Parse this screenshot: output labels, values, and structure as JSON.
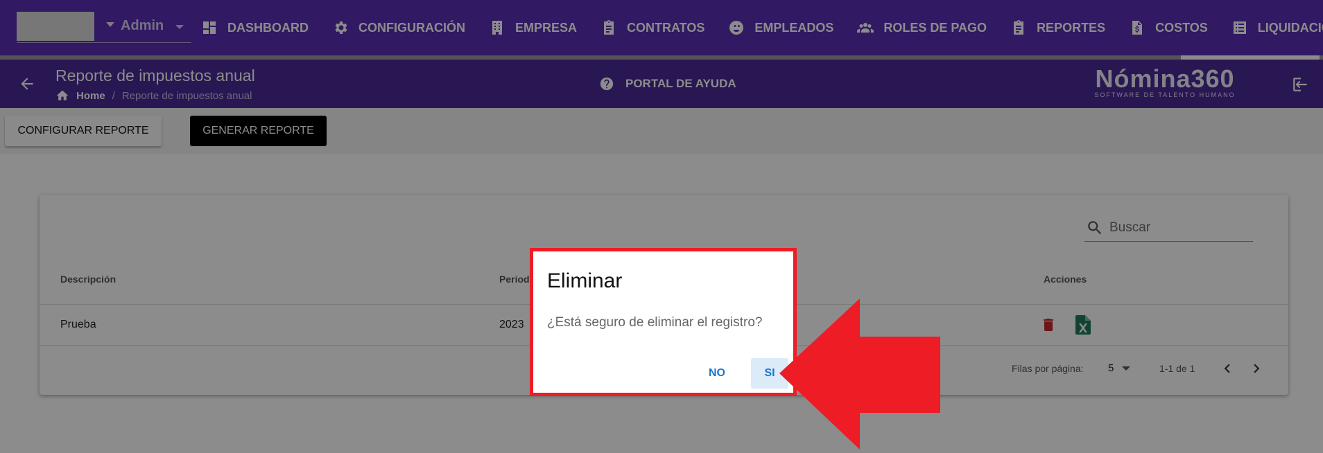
{
  "user": {
    "name": "Admin"
  },
  "nav": {
    "items": [
      {
        "label": "DASHBOARD",
        "icon": "dashboard-icon"
      },
      {
        "label": "CONFIGURACIÓN",
        "icon": "gear-icon"
      },
      {
        "label": "EMPRESA",
        "icon": "building-icon"
      },
      {
        "label": "CONTRATOS",
        "icon": "clipboard-icon"
      },
      {
        "label": "EMPLEADOS",
        "icon": "face-icon"
      },
      {
        "label": "ROLES DE PAGO",
        "icon": "group-icon"
      },
      {
        "label": "REPORTES",
        "icon": "clipboard-icon"
      },
      {
        "label": "COSTOS",
        "icon": "dollar-file-icon"
      },
      {
        "label": "LIQUIDACIONES",
        "icon": "list-icon"
      }
    ]
  },
  "header": {
    "title": "Reporte de impuestos anual",
    "breadcrumb": {
      "home": "Home",
      "separator": "/",
      "current": "Reporte de impuestos anual"
    },
    "help": "PORTAL DE AYUDA",
    "brand": {
      "name": "Nómina360",
      "tagline": "SOFTWARE DE TALENTO HUMANO"
    }
  },
  "toolbar": {
    "configure_label": "CONFIGURAR REPORTE",
    "generate_label": "GENERAR REPORTE"
  },
  "table": {
    "search_placeholder": "Buscar",
    "columns": {
      "description": "Descripción",
      "period": "Periodo",
      "actions": "Acciones"
    },
    "rows": [
      {
        "description": "Prueba",
        "period": "2023"
      }
    ],
    "pagination": {
      "rows_per_page_label": "Filas por página:",
      "rows_per_page": "5",
      "range": "1-1 de 1"
    }
  },
  "dialog": {
    "title": "Eliminar",
    "message": "¿Está seguro de eliminar el registro?",
    "no_label": "NO",
    "yes_label": "SI"
  },
  "colors": {
    "nav_bg": "#5a2fb5",
    "subheader_bg": "#4b2b9a",
    "highlight_red": "#ee1c25",
    "action_blue": "#1976d2",
    "delete_red": "#c62828",
    "excel_green": "#1e7d5a"
  }
}
